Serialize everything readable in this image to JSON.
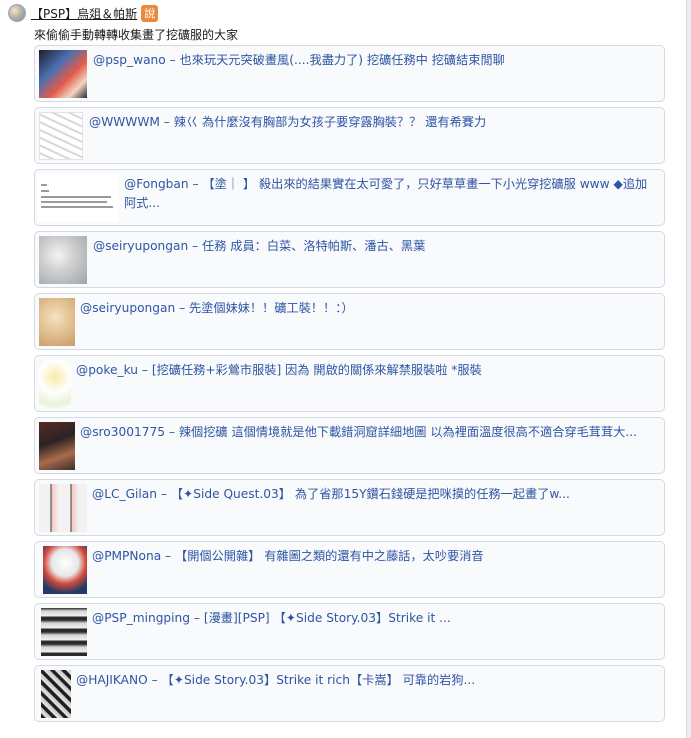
{
  "header": {
    "username": "【PSP】烏爼＆帕斯",
    "badge": "說"
  },
  "subtitle": "來偷偷手動轉轉收集畫了挖礦服的大家",
  "items": [
    {
      "text": "@psp_wano – 也來玩天元突破畫風(....我盡力了) 挖礦任務中 挖礦結束閒聊",
      "thumb": "anime-thumbnail"
    },
    {
      "text": "@WWWWM – 辣巜 為什麼沒有胸部为女孩子要穿露胸裝？？ 還有希賽力",
      "thumb": "sketch-thumbnail"
    },
    {
      "text": "@Fongban – 【塗｜ 】 殺出來的結果實在太可愛了，只好草草畫一下小光穿挖礦服 www ◆追加阿式...",
      "thumb": "text-thumbnail"
    },
    {
      "text": "@seiryupongan – 任務 成員：白菜、洛特帕斯、潘古、黑葉",
      "thumb": "gray-thumbnail"
    },
    {
      "text": "@seiryupongan – 先塗個妹妹！！礦工裝！！：）",
      "thumb": "warm-thumbnail"
    },
    {
      "text": "@poke_ku – [挖礦任務+彩鶯市服裝] 因為 開啟的關係來解禁服裝啦 *服裝",
      "thumb": "chibi-thumbnail"
    },
    {
      "text": "@sro3001775 – 辣個挖礦 這個情境就是他下載錯洞窟詳細地圖 以為裡面溫度很高不適合穿毛茸茸大...",
      "thumb": "dark-thumbnail"
    },
    {
      "text": "@LC_Gilan – 【✦Side Quest.03】 為了省那15Y鑽石錢硬是把咪摸的任務一起畫了w...",
      "thumb": "comic-thumbnail"
    },
    {
      "text": "@PMPNona – 【開個公開雜】 有雜圖之類的還有中之藤話，太吵要消音",
      "thumb": "portrait-thumbnail"
    },
    {
      "text": "@PSP_mingping – [漫畫][PSP] 【✦Side Story.03】Strike it ...",
      "thumb": "manga-thumbnail"
    },
    {
      "text": "@HAJIKANO – 【✦Side Story.03】Strike it rich【卡嵩】 可靠的岩狗...",
      "thumb": "manga-thumbnail-2"
    }
  ]
}
